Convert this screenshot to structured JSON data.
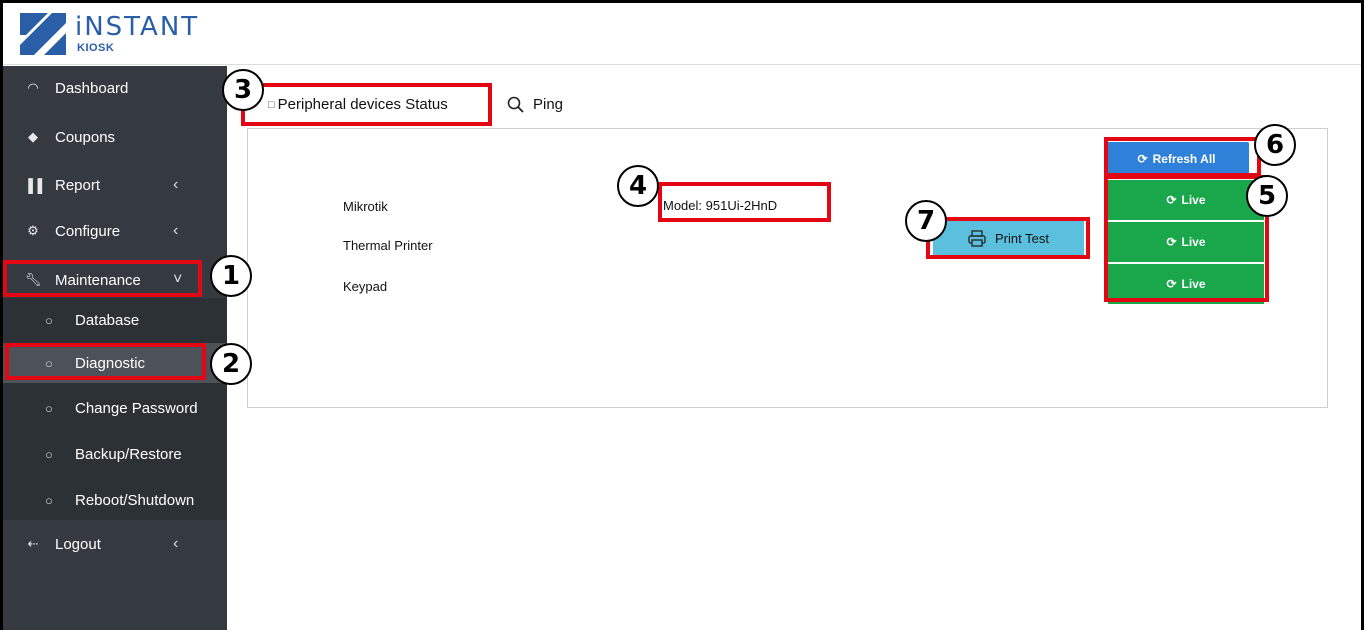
{
  "brand": {
    "word": "iNSTANT",
    "sub": "KIOSK"
  },
  "sidebar": {
    "items": [
      {
        "label": "Dashboard",
        "icon": "gauge-icon"
      },
      {
        "label": "Coupons",
        "icon": "tag-icon"
      },
      {
        "label": "Report",
        "icon": "bar-chart-icon",
        "chevron": "‹"
      },
      {
        "label": "Configure",
        "icon": "gear-icon",
        "chevron": "‹"
      },
      {
        "label": "Maintenance",
        "icon": "wrench-icon",
        "chevron": "˅"
      }
    ],
    "subitems": [
      {
        "label": "Database"
      },
      {
        "label": "Diagnostic"
      },
      {
        "label": "Change Password"
      },
      {
        "label": "Backup/Restore"
      },
      {
        "label": "Reboot/Shutdown"
      }
    ],
    "logout": {
      "label": "Logout",
      "chevron": "‹"
    }
  },
  "tabs": [
    {
      "label": "Peripheral devices Status"
    },
    {
      "label": "Ping"
    }
  ],
  "devices": [
    {
      "name": "Mikrotik",
      "model": "Model: 951Ui-2HnD",
      "status": "Live"
    },
    {
      "name": "Thermal Printer",
      "status": "Live",
      "action": "Print Test"
    },
    {
      "name": "Keypad",
      "status": "Live"
    }
  ],
  "refresh_label": "Refresh All",
  "callouts": [
    "1",
    "2",
    "3",
    "4",
    "5",
    "6",
    "7"
  ],
  "colors": {
    "sidebar": "#353a40",
    "highlight": "#e30613",
    "live": "#1aa74b",
    "refresh": "#2f80d8",
    "print": "#5bc0de",
    "brand": "#2a5fa8"
  }
}
